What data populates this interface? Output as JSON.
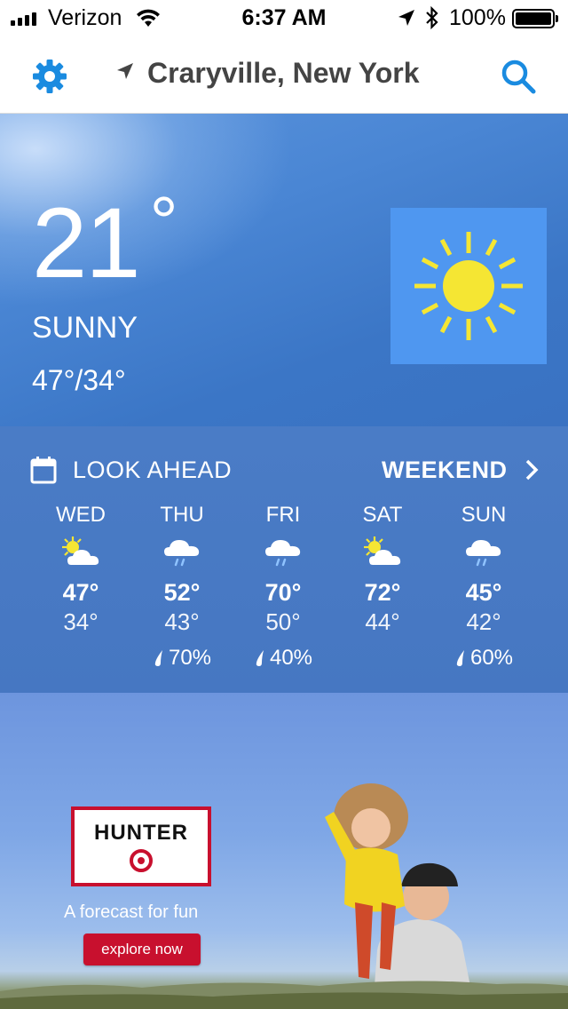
{
  "status_bar": {
    "carrier": "Verizon",
    "time": "6:37 AM",
    "battery": "100%"
  },
  "header": {
    "location": "Craryville, New York"
  },
  "current": {
    "temperature": "21",
    "degree_symbol": "°",
    "condition": "SUNNY",
    "high_low": "47°/34°",
    "icon": "sun-icon"
  },
  "look_ahead": {
    "title": "LOOK AHEAD",
    "link_label": "WEEKEND",
    "days": [
      {
        "name": "WED",
        "icon": "partly-sunny-icon",
        "high": "47°",
        "low": "34°",
        "precip": ""
      },
      {
        "name": "THU",
        "icon": "rain-cloud-icon",
        "high": "52°",
        "low": "43°",
        "precip": "70%"
      },
      {
        "name": "FRI",
        "icon": "rain-cloud-icon",
        "high": "70°",
        "low": "50°",
        "precip": "40%"
      },
      {
        "name": "SAT",
        "icon": "partly-sunny-icon",
        "high": "72°",
        "low": "44°",
        "precip": ""
      },
      {
        "name": "SUN",
        "icon": "rain-cloud-icon",
        "high": "45°",
        "low": "42°",
        "precip": "60%"
      }
    ]
  },
  "ad": {
    "brand": "HUNTER",
    "tagline": "A forecast for fun",
    "cta": "explore now"
  },
  "colors": {
    "accent": "#1a8be0",
    "sun": "#f5e633",
    "icon_box": "#4f97f0",
    "ad_red": "#c8102e"
  }
}
